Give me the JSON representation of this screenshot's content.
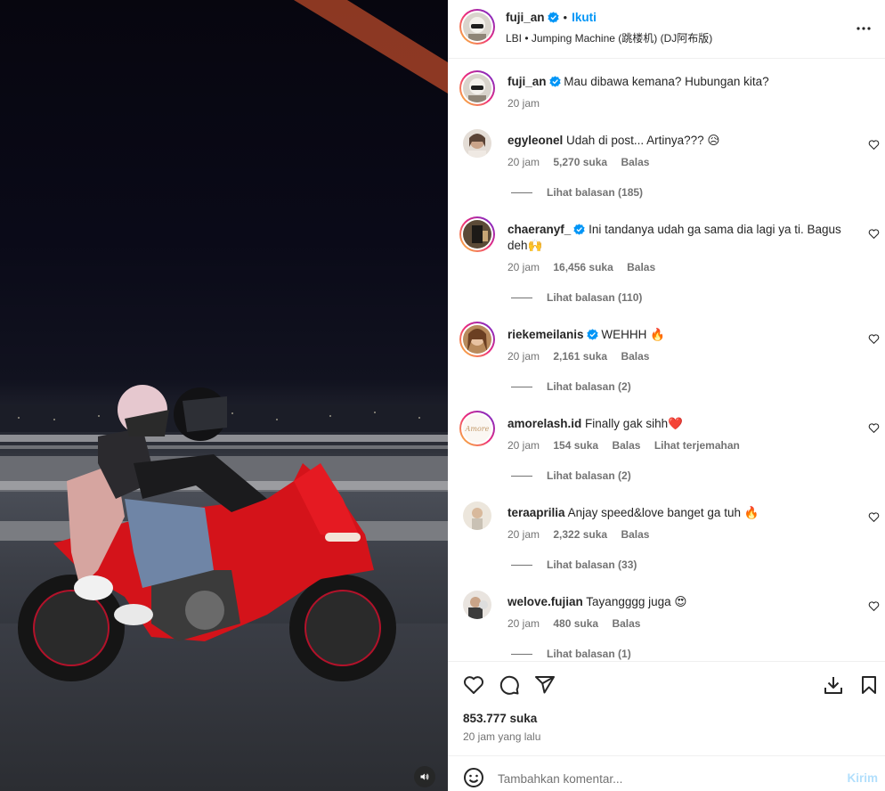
{
  "post": {
    "author": "fuji_an",
    "follow_label": "Ikuti",
    "separator": "•",
    "audio": "LBI • Jumping Machine (跳楼机) (DJ阿布版)",
    "caption": "Mau dibawa kemana? Hubungan kita?",
    "caption_time": "20 jam"
  },
  "comments": [
    {
      "user": "egyleonel",
      "verified": false,
      "text": "Udah di post... Artinya??? 😥",
      "time": "20 jam",
      "likes": "5,270 suka",
      "reply": "Balas",
      "translate": "",
      "replies": "Lihat balasan (185)"
    },
    {
      "user": "chaeranyf_",
      "verified": true,
      "text": "Ini tandanya udah ga sama dia lagi ya ti. Bagus deh🙌",
      "time": "20 jam",
      "likes": "16,456 suka",
      "reply": "Balas",
      "translate": "",
      "replies": "Lihat balasan (110)"
    },
    {
      "user": "riekemeilanis",
      "verified": true,
      "text": "WEHHH 🔥",
      "time": "20 jam",
      "likes": "2,161 suka",
      "reply": "Balas",
      "translate": "",
      "replies": "Lihat balasan (2)"
    },
    {
      "user": "amorelash.id",
      "verified": false,
      "text": "Finally gak sihh❤️",
      "time": "20 jam",
      "likes": "154 suka",
      "reply": "Balas",
      "translate": "Lihat terjemahan",
      "replies": "Lihat balasan (2)"
    },
    {
      "user": "teraaprilia",
      "verified": false,
      "text": "Anjay speed&love banget ga tuh 🔥",
      "time": "20 jam",
      "likes": "2,322 suka",
      "reply": "Balas",
      "translate": "",
      "replies": "Lihat balasan (33)"
    },
    {
      "user": "welove.fujian",
      "verified": false,
      "text": "Tayangggg juga 😍",
      "time": "20 jam",
      "likes": "480 suka",
      "reply": "Balas",
      "translate": "",
      "replies": "Lihat balasan (1)"
    }
  ],
  "footer": {
    "likes": "853.777 suka",
    "time_ago": "20 jam yang lalu",
    "comment_placeholder": "Tambahkan komentar...",
    "send_label": "Kirim"
  },
  "colors": {
    "accent": "#0095f6",
    "send_disabled": "#b2dffc",
    "verified": "#0095f6",
    "muted": "#737373",
    "bike_red": "#d4131a"
  },
  "icons": [
    "more-options-icon",
    "verified-icon",
    "heart-icon",
    "comment-icon",
    "share-icon",
    "save-icon",
    "emoji-icon",
    "audio-icon"
  ]
}
